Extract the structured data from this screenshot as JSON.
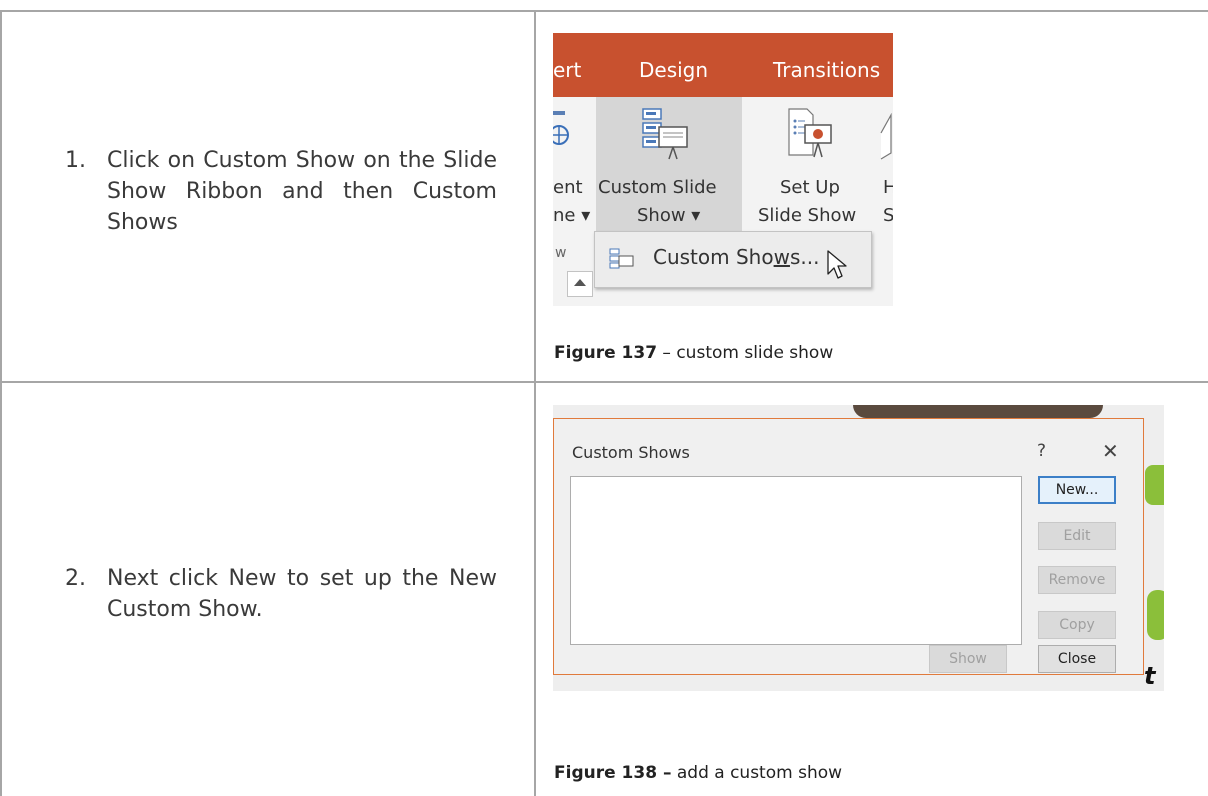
{
  "steps": [
    {
      "number": "1.",
      "text": "Click on Custom Show on the Slide Show Ribbon and then Custom Shows"
    },
    {
      "number": "2.",
      "text": "Next click New to set up the New Custom Show."
    }
  ],
  "figure137": {
    "caption_label": "Figure 137",
    "caption_text": " – custom slide show",
    "tabs": [
      "ert",
      "Design",
      "Transitions"
    ],
    "buttons": {
      "partial_left_line1": "ent",
      "partial_left_line2": "ne ▾",
      "partial_left_line3": "w",
      "custom_slide_line1": "Custom Slide",
      "custom_slide_line2": "Show ▾",
      "setup_line1": "Set Up",
      "setup_line2": "Slide Show",
      "partial_right_line1": "H",
      "partial_right_line2": "S"
    },
    "menu_item_pre": "Custom Sho",
    "menu_item_ul": "w",
    "menu_item_post": "s...",
    "accent_color": "#c8512f"
  },
  "figure138": {
    "caption_label": "Figure 138 –",
    "caption_text": " add a custom show",
    "dialog_title": "Custom Shows",
    "help": "?",
    "close_x": "✕",
    "buttons": {
      "new": "New...",
      "edit": "Edit",
      "remove": "Remove",
      "copy": "Copy",
      "show": "Show",
      "close": "Close"
    },
    "deco_letter": "t"
  }
}
